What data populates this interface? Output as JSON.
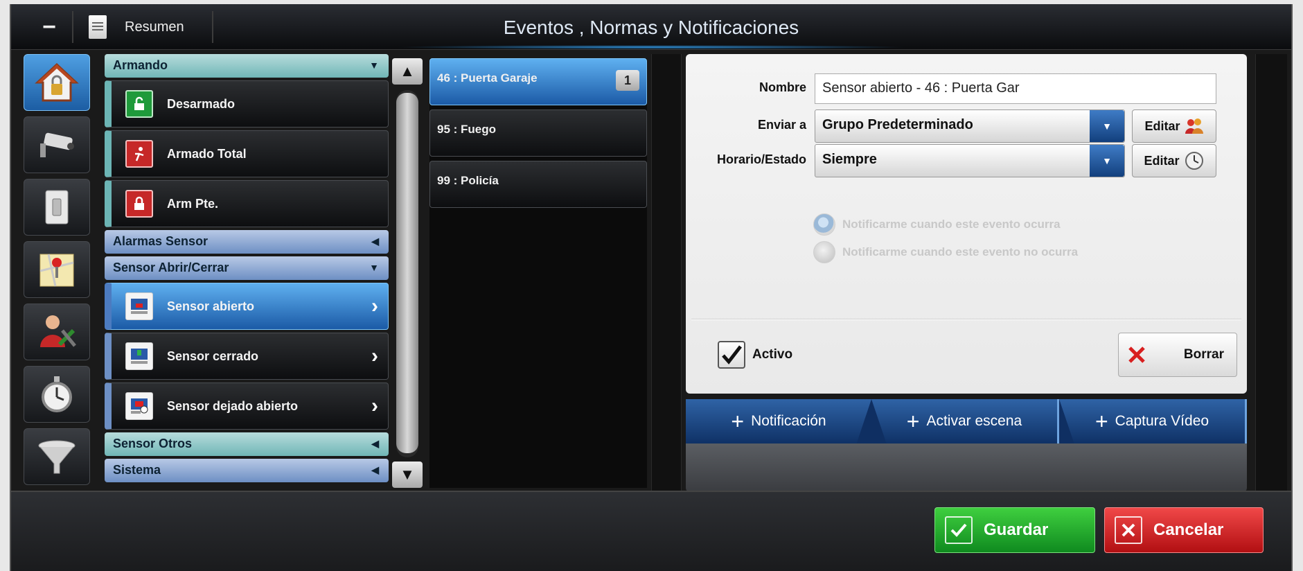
{
  "titlebar": {
    "resumen": "Resumen",
    "title": "Eventos , Normas y Notificaciones"
  },
  "categories": {
    "armando": {
      "header": "Armando",
      "items": [
        {
          "label": "Desarmado"
        },
        {
          "label": "Armado Total"
        },
        {
          "label": "Arm Pte."
        }
      ]
    },
    "alarmas_sensor": {
      "header": "Alarmas Sensor"
    },
    "sensor_abrir_cerrar": {
      "header": "Sensor Abrir/Cerrar",
      "items": [
        {
          "label": "Sensor abierto"
        },
        {
          "label": "Sensor cerrado"
        },
        {
          "label": "Sensor dejado abierto"
        }
      ]
    },
    "sensor_otros": {
      "header": "Sensor Otros"
    },
    "sistema": {
      "header": "Sistema"
    }
  },
  "events": [
    {
      "label": "46 : Puerta Garaje",
      "count": "1"
    },
    {
      "label": "95 : Fuego"
    },
    {
      "label": "99 : Policía"
    }
  ],
  "form": {
    "nombre_label": "Nombre",
    "nombre_value": "Sensor abierto - 46 : Puerta Gar",
    "enviar_label": "Enviar a",
    "enviar_value": "Grupo Predeterminado",
    "horario_label": "Horario/Estado",
    "horario_value": "Siempre",
    "editar": "Editar",
    "radio_occurs": "Notificarme cuando este evento ocurra",
    "radio_not_occurs": "Notificarme cuando este evento no ocurra",
    "activo": "Activo",
    "borrar": "Borrar"
  },
  "tabs": [
    {
      "label": "Notificación"
    },
    {
      "label": "Activar escena"
    },
    {
      "label": "Captura Vídeo"
    }
  ],
  "footer": {
    "guardar": "Guardar",
    "cancelar": "Cancelar"
  },
  "colors": {
    "accent_blue": "#1b5aa6",
    "save_green": "#0f8a1f",
    "cancel_red": "#b20f12",
    "category_teal": "#70b6b6"
  }
}
